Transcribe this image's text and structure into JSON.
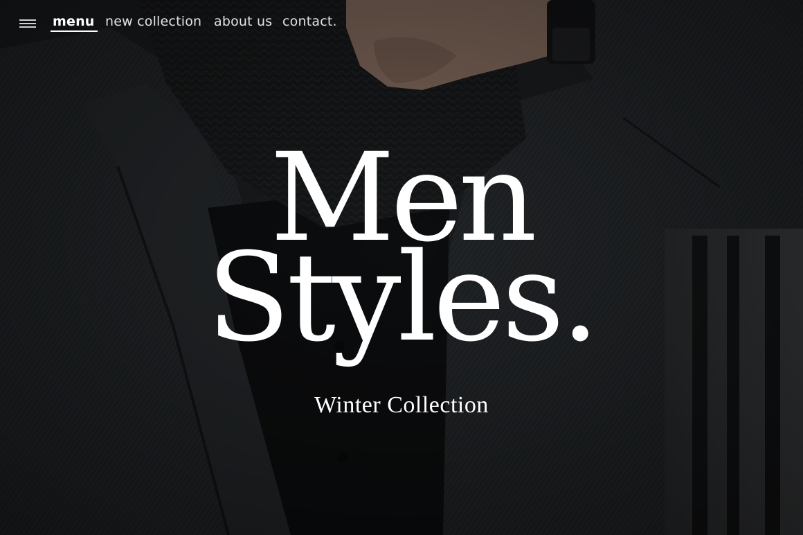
{
  "nav": {
    "menu_icon": "hamburger-menu-icon",
    "items": [
      {
        "label": "menu",
        "active": true
      },
      {
        "label": "new collection",
        "active": false
      },
      {
        "label": "about us",
        "active": false
      },
      {
        "label": "contact.",
        "active": false
      }
    ]
  },
  "hero": {
    "title_line1": "Men",
    "title_line2": "Styles.",
    "subtitle": "Winter Collection"
  },
  "colors": {
    "text": "#ffffff",
    "nav_text": "#e2e3e4",
    "background": "#1e2124"
  }
}
